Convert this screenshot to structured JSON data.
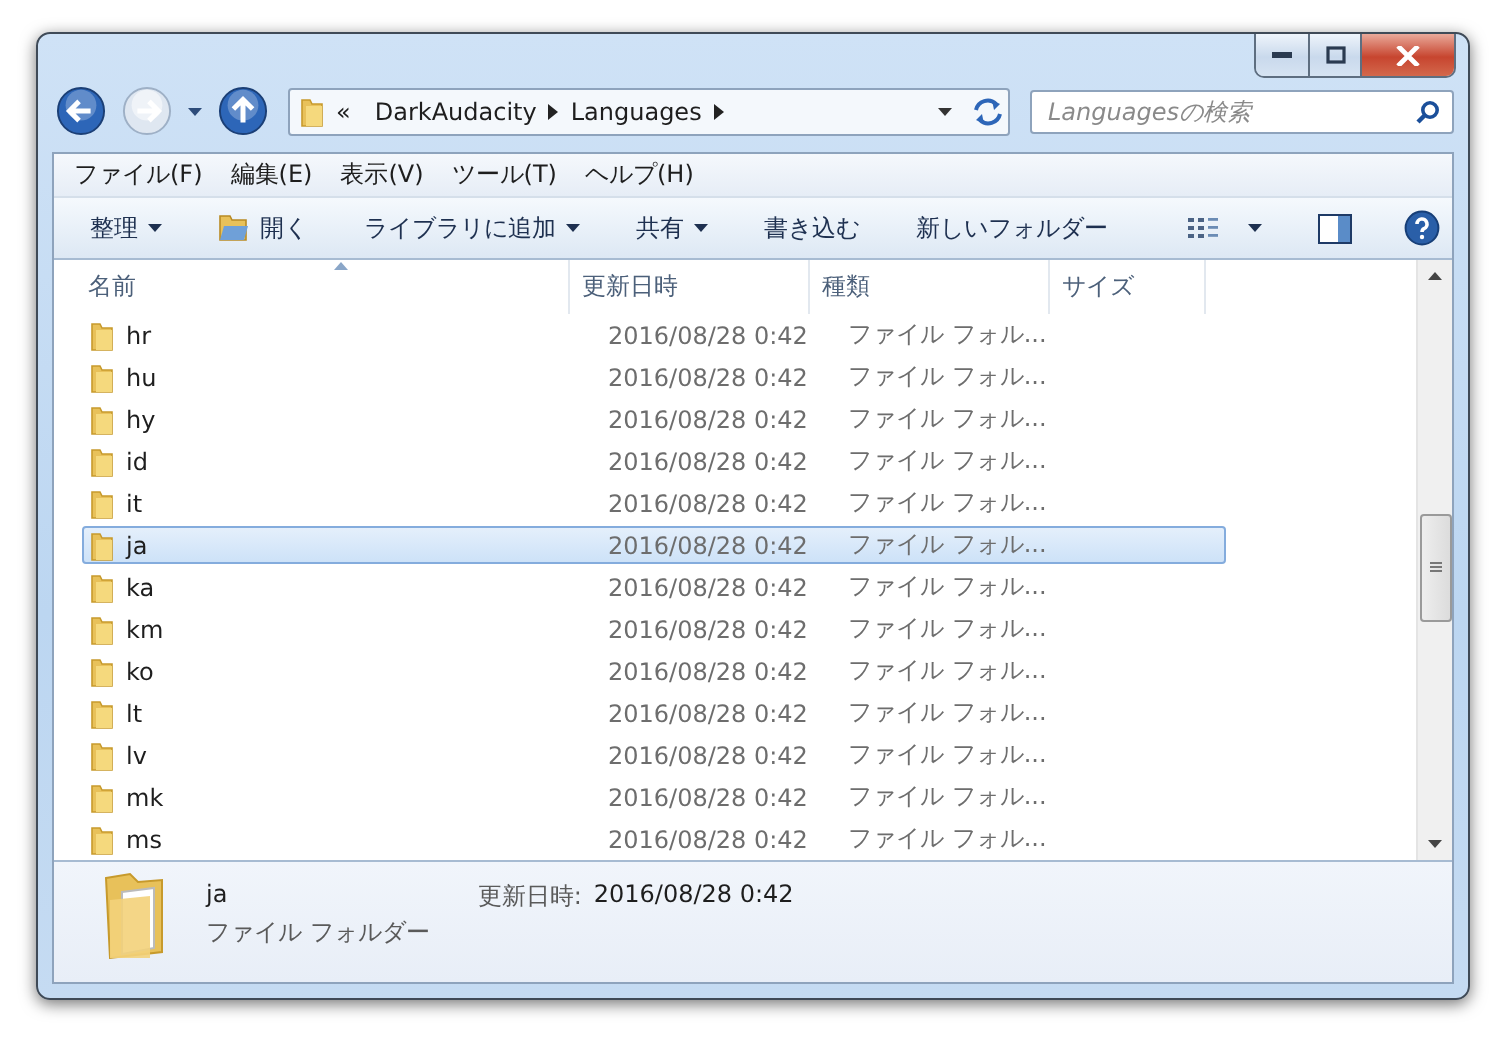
{
  "address": {
    "overflow": "«",
    "crumbs": [
      "DarkAudacity",
      "Languages"
    ]
  },
  "search": {
    "placeholder": "Languagesの検索"
  },
  "menu": [
    "ファイル(F)",
    "編集(E)",
    "表示(V)",
    "ツール(T)",
    "ヘルプ(H)"
  ],
  "toolbar": [
    {
      "label": "整理",
      "kind": "menu"
    },
    {
      "label": "開く",
      "kind": "open"
    },
    {
      "label": "ライブラリに追加",
      "kind": "menu"
    },
    {
      "label": "共有",
      "kind": "menu"
    },
    {
      "label": "書き込む",
      "kind": "button"
    },
    {
      "label": "新しいフォルダー",
      "kind": "button"
    }
  ],
  "columns": [
    "名前",
    "更新日時",
    "種類",
    "サイズ"
  ],
  "rows": [
    {
      "name": "hr",
      "date": "2016/08/28 0:42",
      "type": "ファイル フォル...",
      "selected": false
    },
    {
      "name": "hu",
      "date": "2016/08/28 0:42",
      "type": "ファイル フォル...",
      "selected": false
    },
    {
      "name": "hy",
      "date": "2016/08/28 0:42",
      "type": "ファイル フォル...",
      "selected": false
    },
    {
      "name": "id",
      "date": "2016/08/28 0:42",
      "type": "ファイル フォル...",
      "selected": false
    },
    {
      "name": "it",
      "date": "2016/08/28 0:42",
      "type": "ファイル フォル...",
      "selected": false
    },
    {
      "name": "ja",
      "date": "2016/08/28 0:42",
      "type": "ファイル フォル...",
      "selected": true
    },
    {
      "name": "ka",
      "date": "2016/08/28 0:42",
      "type": "ファイル フォル...",
      "selected": false
    },
    {
      "name": "km",
      "date": "2016/08/28 0:42",
      "type": "ファイル フォル...",
      "selected": false
    },
    {
      "name": "ko",
      "date": "2016/08/28 0:42",
      "type": "ファイル フォル...",
      "selected": false
    },
    {
      "name": "lt",
      "date": "2016/08/28 0:42",
      "type": "ファイル フォル...",
      "selected": false
    },
    {
      "name": "lv",
      "date": "2016/08/28 0:42",
      "type": "ファイル フォル...",
      "selected": false
    },
    {
      "name": "mk",
      "date": "2016/08/28 0:42",
      "type": "ファイル フォル...",
      "selected": false
    },
    {
      "name": "ms",
      "date": "2016/08/28 0:42",
      "type": "ファイル フォル...",
      "selected": false
    }
  ],
  "details": {
    "name": "ja",
    "date_label": "更新日時:",
    "date": "2016/08/28 0:42",
    "type": "ファイル フォルダー"
  }
}
